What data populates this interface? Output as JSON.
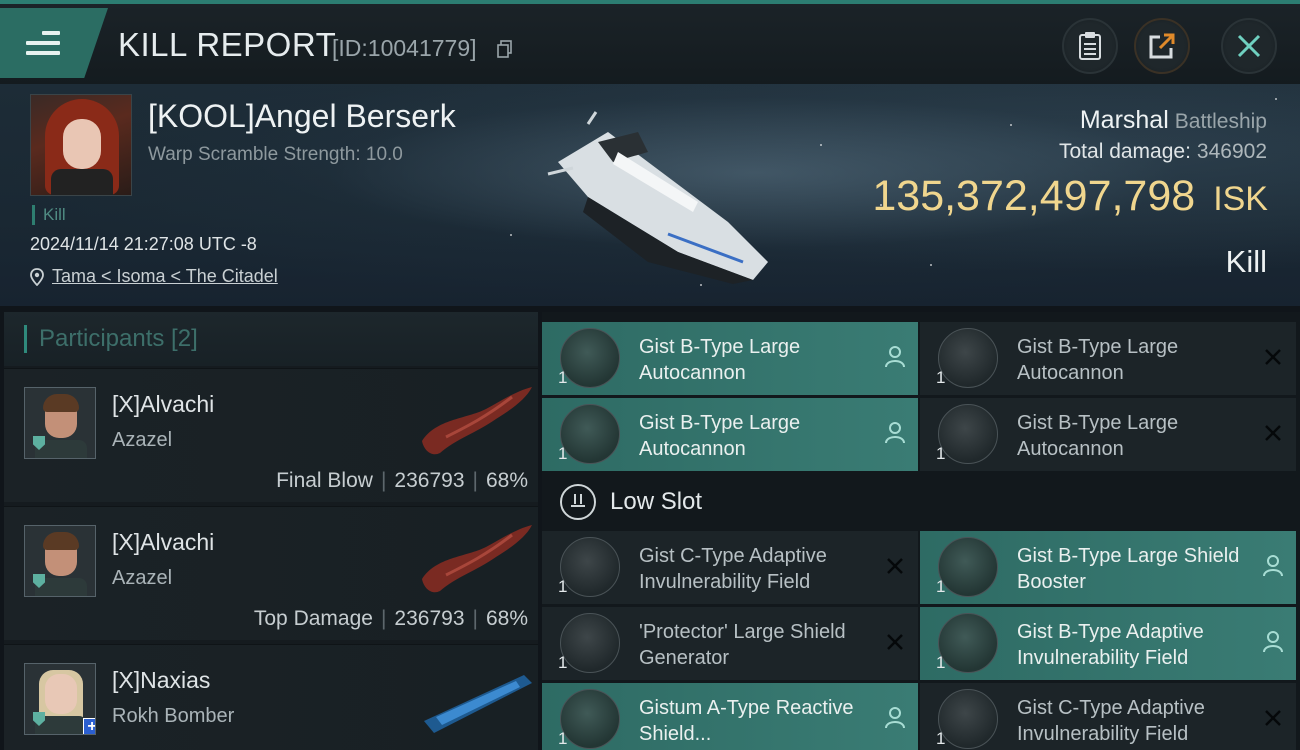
{
  "header": {
    "title": "KILL REPORT",
    "report_id": "[ID:10041779]"
  },
  "victim": {
    "name": "[KOOL]Angel Berserk",
    "warp_scramble": "Warp Scramble Strength: 10.0",
    "kill_tag": "Kill",
    "time": "2024/11/14 21:27:08 UTC -8",
    "location": "Tama < Isoma < The Citadel"
  },
  "ship": {
    "name": "Marshal",
    "class": "Battleship",
    "total_damage_label": "Total damage:",
    "total_damage": "346902",
    "isk_value": "135,372,497,798",
    "isk_unit": "ISK",
    "result": "Kill"
  },
  "participants": {
    "label": "Participants [2]",
    "items": [
      {
        "name": "[X]Alvachi",
        "ship": "Azazel",
        "role": "Final Blow",
        "damage": "236793",
        "percent": "68%"
      },
      {
        "name": "[X]Alvachi",
        "ship": "Azazel",
        "role": "Top Damage",
        "damage": "236793",
        "percent": "68%"
      },
      {
        "name": "[X]Naxias",
        "ship": "Rokh Bomber"
      }
    ]
  },
  "modules": {
    "high": [
      {
        "name": "Gist B-Type Large Autocannon",
        "qty": "1",
        "status": "pilot",
        "highlight": true
      },
      {
        "name": "Gist B-Type Large Autocannon",
        "qty": "1",
        "status": "destroyed",
        "highlight": false
      },
      {
        "name": "Gist B-Type Large Autocannon",
        "qty": "1",
        "status": "pilot",
        "highlight": true
      },
      {
        "name": "Gist B-Type Large Autocannon",
        "qty": "1",
        "status": "destroyed",
        "highlight": false
      }
    ],
    "low_slot_label": "Low Slot",
    "low": [
      {
        "name": "Gist C-Type Adaptive Invulnerability Field",
        "qty": "1",
        "status": "destroyed",
        "highlight": false
      },
      {
        "name": "Gist B-Type Large Shield Booster",
        "qty": "1",
        "status": "pilot",
        "highlight": true
      },
      {
        "name": "'Protector' Large Shield Generator",
        "qty": "1",
        "status": "destroyed",
        "highlight": false
      },
      {
        "name": "Gist B-Type Adaptive Invulnerability Field",
        "qty": "1",
        "status": "pilot",
        "highlight": true
      },
      {
        "name": "Gistum A-Type Reactive Shield...",
        "qty": "1",
        "status": "pilot",
        "highlight": true
      },
      {
        "name": "Gist C-Type Adaptive Invulnerability Field",
        "qty": "1",
        "status": "destroyed",
        "highlight": false
      }
    ]
  },
  "colors": {
    "accent": "#2b6d63",
    "isk": "#f0d68e",
    "module_highlight": "#3a7c74"
  }
}
